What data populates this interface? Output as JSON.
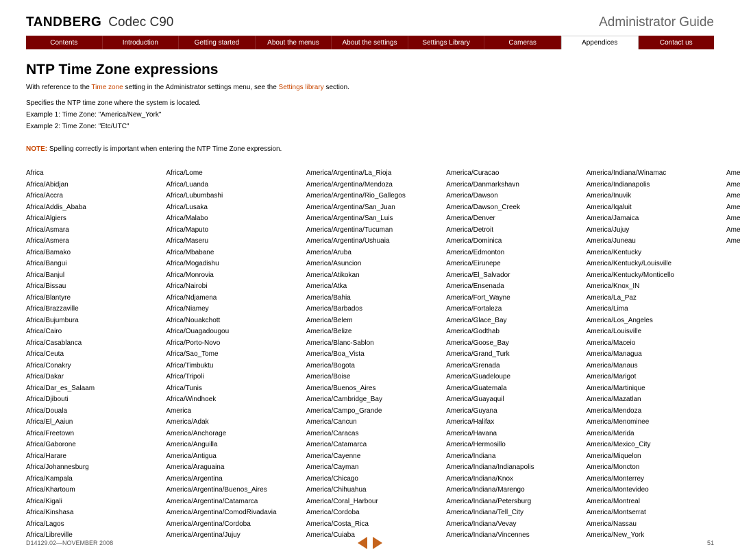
{
  "header": {
    "brand": "TANDBERG",
    "model": "Codec C90",
    "guide": "Administrator Guide"
  },
  "nav": [
    {
      "label": "Contents",
      "active": false
    },
    {
      "label": "Introduction",
      "active": false
    },
    {
      "label": "Getting started",
      "active": false
    },
    {
      "label": "About the menus",
      "active": false
    },
    {
      "label": "About the settings",
      "active": false
    },
    {
      "label": "Settings Library",
      "active": false
    },
    {
      "label": "Cameras",
      "active": false
    },
    {
      "label": "Appendices",
      "active": true
    },
    {
      "label": "Contact us",
      "active": false
    }
  ],
  "content": {
    "title": "NTP Time Zone expressions",
    "intro_pre": "With reference to the ",
    "intro_link1": "Time zone",
    "intro_mid": " setting in the Administrator settings menu, see the ",
    "intro_link2": "Settings library",
    "intro_post": " section.",
    "spec": "Specifies the NTP time zone where the system is located.",
    "ex1": "Example 1: Time Zone: \"America/New_York\"",
    "ex2": "Example 2: Time Zone: \"Etc/UTC\"",
    "note_label": "NOTE:",
    "note_text": " Spelling correctly is important when entering the NTP Time Zone expression.",
    "timezones": [
      "Africa",
      "Africa/Abidjan",
      "Africa/Accra",
      "Africa/Addis_Ababa",
      "Africa/Algiers",
      "Africa/Asmara",
      "Africa/Asmera",
      "Africa/Bamako",
      "Africa/Bangui",
      "Africa/Banjul",
      "Africa/Bissau",
      "Africa/Blantyre",
      "Africa/Brazzaville",
      "Africa/Bujumbura",
      "Africa/Cairo",
      "Africa/Casablanca",
      "Africa/Ceuta",
      "Africa/Conakry",
      "Africa/Dakar",
      "Africa/Dar_es_Salaam",
      "Africa/Djibouti",
      "Africa/Douala",
      "Africa/El_Aaiun",
      "Africa/Freetown",
      "Africa/Gaborone",
      "Africa/Harare",
      "Africa/Johannesburg",
      "Africa/Kampala",
      "Africa/Khartoum",
      "Africa/Kigali",
      "Africa/Kinshasa",
      "Africa/Lagos",
      "Africa/Libreville",
      "Africa/Lome",
      "Africa/Luanda",
      "Africa/Lubumbashi",
      "Africa/Lusaka",
      "Africa/Malabo",
      "Africa/Maputo",
      "Africa/Maseru",
      "Africa/Mbabane",
      "Africa/Mogadishu",
      "Africa/Monrovia",
      "Africa/Nairobi",
      "Africa/Ndjamena",
      "Africa/Niamey",
      "Africa/Nouakchott",
      "Africa/Ouagadougou",
      "Africa/Porto-Novo",
      "Africa/Sao_Tome",
      "Africa/Timbuktu",
      "Africa/Tripoli",
      "Africa/Tunis",
      "Africa/Windhoek",
      "America",
      "America/Adak",
      "America/Anchorage",
      "America/Anguilla",
      "America/Antigua",
      "America/Araguaina",
      "America/Argentina",
      "America/Argentina/Buenos_Aires",
      "America/Argentina/Catamarca",
      "America/Argentina/ComodRivadavia",
      "America/Argentina/Cordoba",
      "America/Argentina/Jujuy",
      "America/Argentina/La_Rioja",
      "America/Argentina/Mendoza",
      "America/Argentina/Rio_Gallegos",
      "America/Argentina/San_Juan",
      "America/Argentina/San_Luis",
      "America/Argentina/Tucuman",
      "America/Argentina/Ushuaia",
      "America/Aruba",
      "America/Asuncion",
      "America/Atikokan",
      "America/Atka",
      "America/Bahia",
      "America/Barbados",
      "America/Belem",
      "America/Belize",
      "America/Blanc-Sablon",
      "America/Boa_Vista",
      "America/Bogota",
      "America/Boise",
      "America/Buenos_Aires",
      "America/Cambridge_Bay",
      "America/Campo_Grande",
      "America/Cancun",
      "America/Caracas",
      "America/Catamarca",
      "America/Cayenne",
      "America/Cayman",
      "America/Chicago",
      "America/Chihuahua",
      "America/Coral_Harbour",
      "America/Cordoba",
      "America/Costa_Rica",
      "America/Cuiaba",
      "America/Curacao",
      "America/Danmarkshavn",
      "America/Dawson",
      "America/Dawson_Creek",
      "America/Denver",
      "America/Detroit",
      "America/Dominica",
      "America/Edmonton",
      "America/Eirunepe",
      "America/El_Salvador",
      "America/Ensenada",
      "America/Fort_Wayne",
      "America/Fortaleza",
      "America/Glace_Bay",
      "America/Godthab",
      "America/Goose_Bay",
      "America/Grand_Turk",
      "America/Grenada",
      "America/Guadeloupe",
      "America/Guatemala",
      "America/Guayaquil",
      "America/Guyana",
      "America/Halifax",
      "America/Havana",
      "America/Hermosillo",
      "America/Indiana",
      "America/Indiana/Indianapolis",
      "America/Indiana/Knox",
      "America/Indiana/Marengo",
      "America/Indiana/Petersburg",
      "America/Indiana/Tell_City",
      "America/Indiana/Vevay",
      "America/Indiana/Vincennes",
      "America/Indiana/Winamac",
      "America/Indianapolis",
      "America/Inuvik",
      "America/Iqaluit",
      "America/Jamaica",
      "America/Jujuy",
      "America/Juneau",
      "America/Kentucky",
      "America/Kentucky/Louisville",
      "America/Kentucky/Monticello",
      "America/Knox_IN",
      "America/La_Paz",
      "America/Lima",
      "America/Los_Angeles",
      "America/Louisville",
      "America/Maceio",
      "America/Managua",
      "America/Manaus",
      "America/Marigot",
      "America/Martinique",
      "America/Mazatlan",
      "America/Mendoza",
      "America/Menominee",
      "America/Merida",
      "America/Mexico_City",
      "America/Miquelon",
      "America/Moncton",
      "America/Monterrey",
      "America/Montevideo",
      "America/Montreal",
      "America/Montserrat",
      "America/Nassau",
      "America/New_York",
      "America/Nipigon",
      "America/Nome",
      "America/Noronha",
      "America/North_Dakota",
      "America/North_Dakota/Center",
      "America/North_Dakota/New_Salem",
      "America/Panama"
    ]
  },
  "footer": {
    "docid": "D14129.02—NOVEMBER 2008",
    "page": "51"
  }
}
